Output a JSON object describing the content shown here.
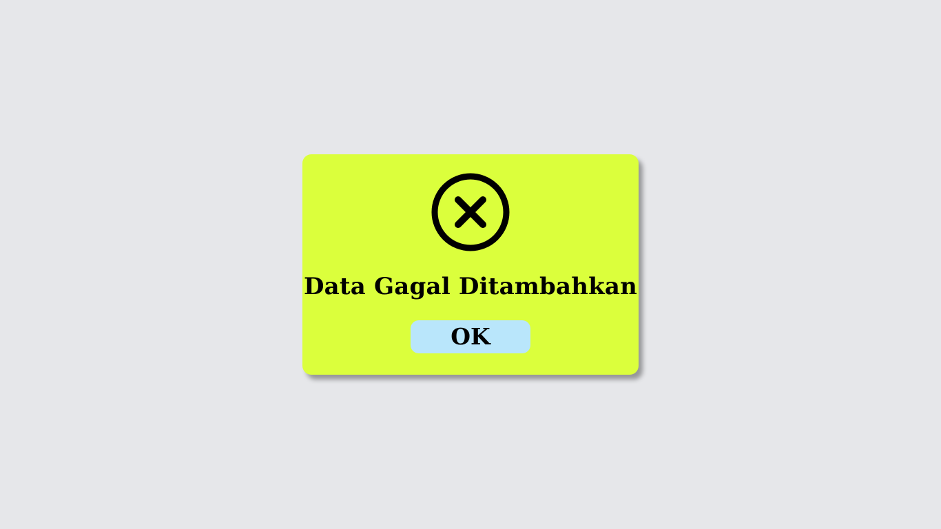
{
  "dialog": {
    "icon": "close-circle-icon",
    "message": "Data Gagal Ditambahkan",
    "ok_label": "OK"
  },
  "colors": {
    "background": "#e6e7ea",
    "dialog_bg": "#dbff3c",
    "button_bg": "#b9e6fb",
    "text": "#000000"
  }
}
